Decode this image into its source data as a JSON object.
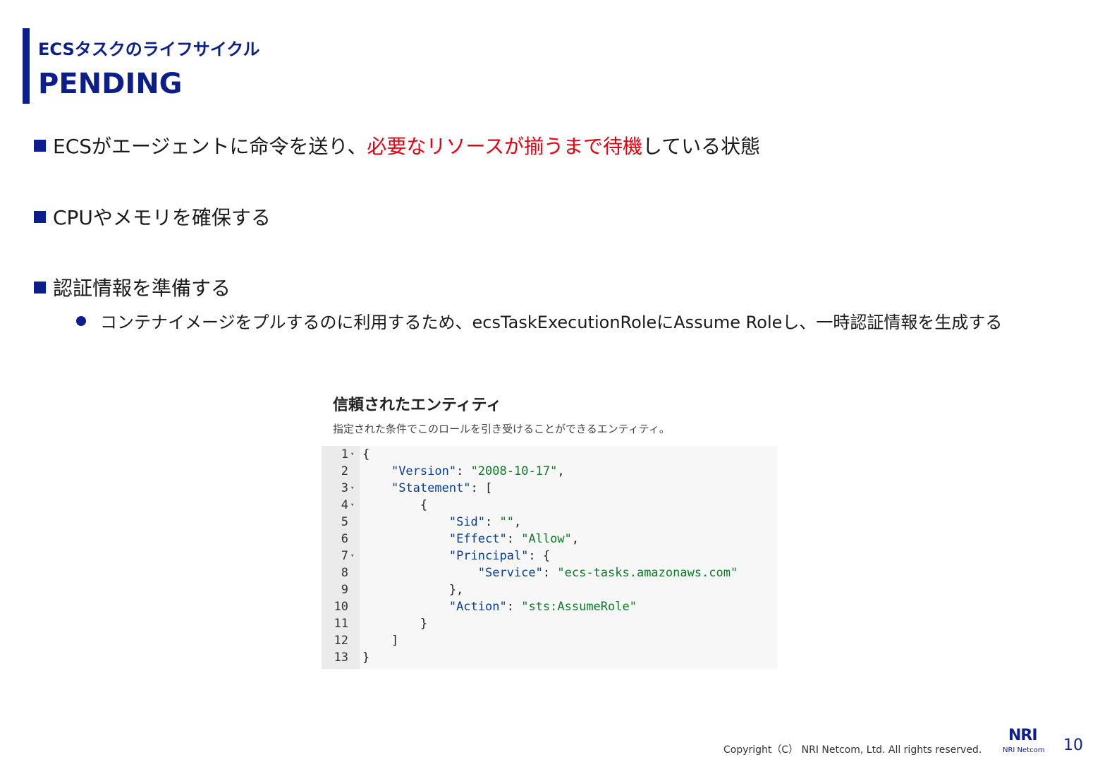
{
  "header": {
    "subtitle": "ECSタスクのライフサイクル",
    "title": "PENDING"
  },
  "bullets": [
    {
      "prefix": "ECSがエージェントに命令を送り、",
      "highlight": "必要なリソースが揃うまで待機",
      "suffix": "している状態"
    },
    {
      "text": "CPUやメモリを確保する"
    },
    {
      "text": "認証情報を準備する",
      "sub": "コンテナイメージをプルするのに利用するため、ecsTaskExecutionRoleにAssume Roleし、一時認証情報を生成する"
    }
  ],
  "panel": {
    "title": "信頼されたエンティティ",
    "description": "指定された条件でこのロールを引き受けることができるエンティティ。",
    "code_lines": [
      "{",
      "    \"Version\": \"2008-10-17\",",
      "    \"Statement\": [",
      "        {",
      "            \"Sid\": \"\",",
      "            \"Effect\": \"Allow\",",
      "            \"Principal\": {",
      "                \"Service\": \"ecs-tasks.amazonaws.com\"",
      "            },",
      "            \"Action\": \"sts:AssumeRole\"",
      "        }",
      "    ]",
      "}"
    ]
  },
  "footer": {
    "copyright": "Copyright（C） NRI Netcom, Ltd. All rights reserved.",
    "logo_mark": "NRI",
    "logo_text": "NRI Netcom",
    "page_number": "10"
  },
  "colors": {
    "brand": "#0b1e8c",
    "highlight": "#e60012"
  }
}
